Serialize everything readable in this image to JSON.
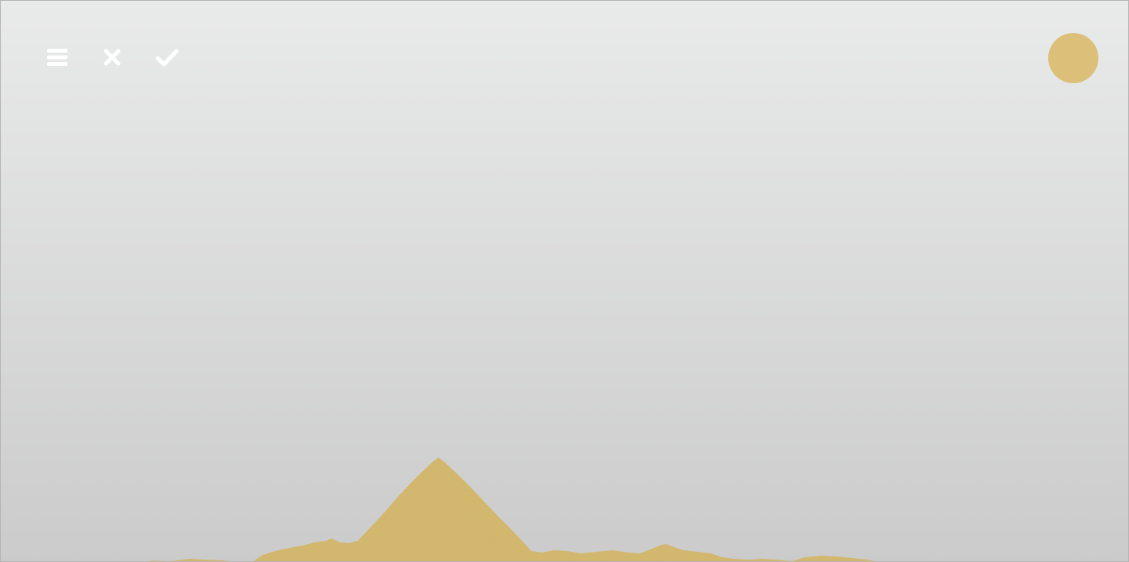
{
  "app": {
    "toolbar": {
      "menu_icon": "menu-icon",
      "clear_icon": "close-icon",
      "confirm_icon": "check-icon",
      "icon_color": "#ffffff"
    },
    "color_picker": {
      "current_color": "#dcc07a"
    },
    "canvas": {
      "background_top": "#e9eaea",
      "background_bottom": "#cbcbcb",
      "sand_color": "#d8bb70"
    }
  }
}
